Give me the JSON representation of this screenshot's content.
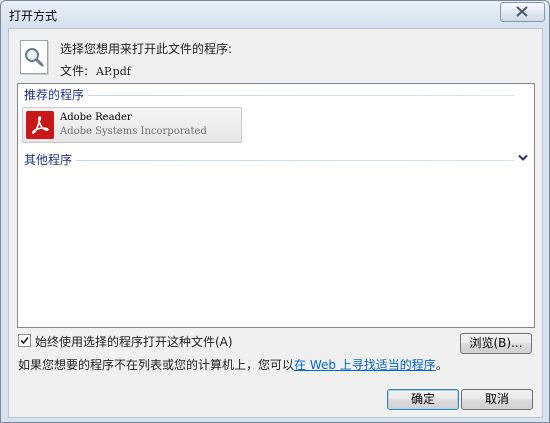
{
  "window": {
    "title": "打开方式"
  },
  "header": {
    "prompt": "选择您想用来打开此文件的程序:",
    "file_label": "文件:",
    "file_name": "AP.pdf"
  },
  "groups": {
    "recommended": {
      "label": "推荐的程序"
    },
    "other": {
      "label": "其他程序"
    }
  },
  "programs": [
    {
      "name": "Adobe Reader",
      "publisher": "Adobe Systems Incorporated",
      "icon": "adobe-reader-icon",
      "color": "#c8181a"
    }
  ],
  "always_use": {
    "label": "始终使用选择的程序打开这种文件(A)",
    "checked": true
  },
  "browse_label": "浏览(B)...",
  "hint": {
    "text": "如果您想要的程序不在列表或您的计算机上，您可以",
    "link": "在 Web 上寻找适当的程序",
    "end": "。"
  },
  "buttons": {
    "ok": "确定",
    "cancel": "取消"
  }
}
